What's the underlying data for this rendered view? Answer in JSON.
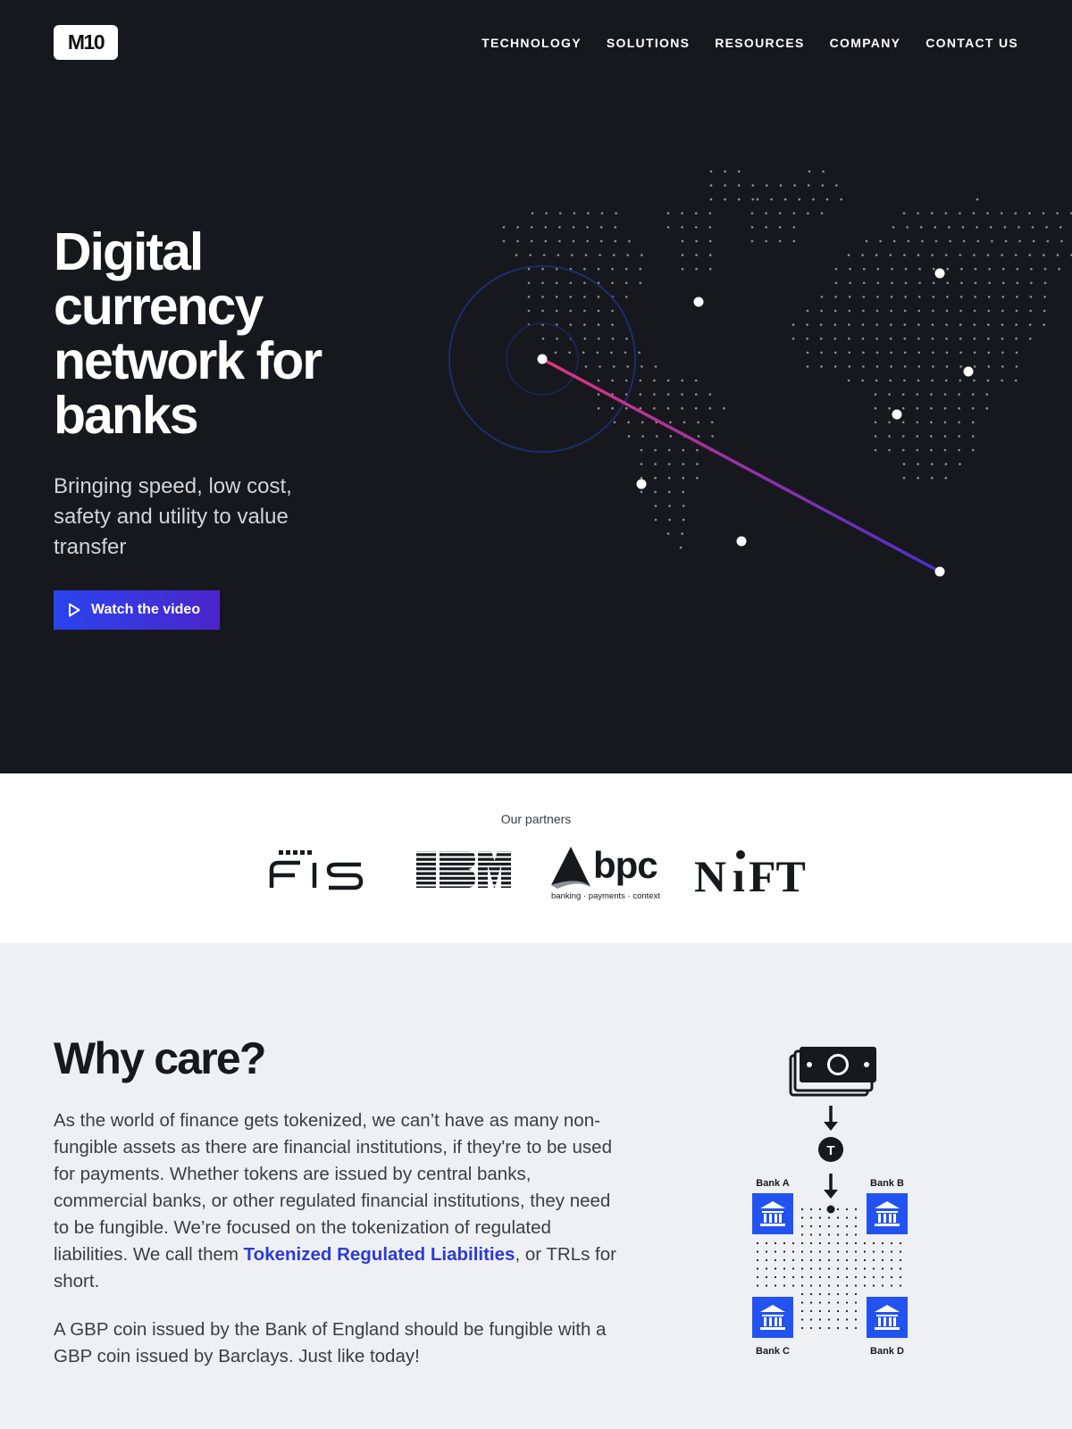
{
  "nav": {
    "logo": "M10",
    "links": [
      "TECHNOLOGY",
      "SOLUTIONS",
      "RESOURCES",
      "COMPANY",
      "CONTACT US"
    ]
  },
  "hero": {
    "title": "Digital currency network for banks",
    "subtitle": "Bringing speed, low cost, safety and utility to value transfer",
    "cta_label": "Watch the video",
    "cta_icon": "play-icon",
    "colors": {
      "background": "#17181d",
      "line_start": "#e0357e",
      "line_end": "#4a2fd1",
      "ring": "#1f2f6b"
    }
  },
  "partners": {
    "label": "Our partners",
    "logos": [
      "fis",
      "IBM",
      "bpc",
      "NIFT"
    ],
    "bpc_tagline": "banking · payments · context"
  },
  "why": {
    "title": "Why care?",
    "para1_before": "As the world of finance gets tokenized, we can’t have as many non-fungible assets as there are financial institutions, if they're to be used for payments. Whether tokens are issued by central banks, commercial banks, or other regulated financial institutions, they need to be fungible. We’re focused on the tokenization of regulated liabilities. We call them ",
    "para1_link": "Tokenized Regulated Liabilities",
    "para1_after": ", or TRLs for short.",
    "para2": "A GBP coin issued by the Bank of England should be fungible with a GBP coin issued by Barclays. Just like today!",
    "diagram": {
      "token_label": "T",
      "banks": [
        "Bank A",
        "Bank B",
        "Bank C",
        "Bank D"
      ],
      "icons": [
        "cash-icon",
        "down-arrow-icon",
        "token-icon",
        "bank-icon"
      ],
      "accent": "#2253f0"
    }
  }
}
